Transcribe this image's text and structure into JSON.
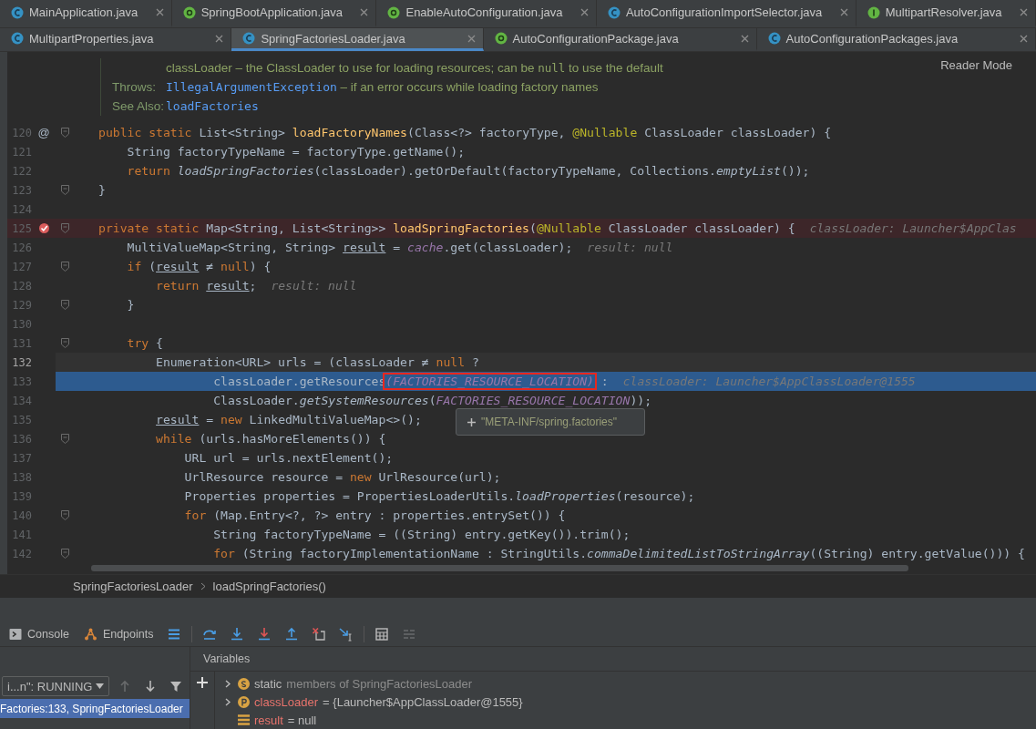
{
  "tab_rows": [
    [
      {
        "label": "MainApplication.java",
        "kind": "class",
        "selected": false
      },
      {
        "label": "SpringBootApplication.java",
        "kind": "annotation",
        "selected": false
      },
      {
        "label": "EnableAutoConfiguration.java",
        "kind": "annotation",
        "selected": false
      },
      {
        "label": "AutoConfigurationImportSelector.java",
        "kind": "class",
        "selected": false
      },
      {
        "label": "MultipartResolver.java",
        "kind": "interface",
        "selected": false
      }
    ],
    [
      {
        "label": "MultipartProperties.java",
        "kind": "class",
        "selected": false
      },
      {
        "label": "SpringFactoriesLoader.java",
        "kind": "class",
        "selected": true
      },
      {
        "label": "AutoConfigurationPackage.java",
        "kind": "annotation",
        "selected": false
      },
      {
        "label": "AutoConfigurationPackages.java",
        "kind": "class",
        "selected": false
      }
    ]
  ],
  "reader_mode": "Reader Mode",
  "doc": [
    {
      "parts": [
        {
          "kind": "text",
          "text": "classLoader – the ClassLoader to use for loading resources; can be "
        },
        {
          "kind": "mono",
          "text": "null"
        },
        {
          "kind": "text",
          "text": " to use the default"
        }
      ]
    },
    {
      "label": "Throws:",
      "parts": [
        {
          "kind": "link",
          "text": "IllegalArgumentException"
        },
        {
          "kind": "text",
          "text": " – if an error occurs while loading factory names"
        }
      ]
    },
    {
      "label": "See Also:",
      "parts": [
        {
          "kind": "link",
          "text": "loadFactories"
        }
      ]
    }
  ],
  "lines": [
    {
      "number": "120",
      "kind": "normal",
      "gutter_text": "@",
      "fold": true,
      "tokens": [
        {
          "kind": "kw",
          "text": "public static "
        },
        {
          "kind": "plain",
          "text": "List<String> "
        },
        {
          "kind": "decl",
          "text": "loadFactoryNames"
        },
        {
          "kind": "plain",
          "text": "(Class<?> factoryType, "
        },
        {
          "kind": "ann",
          "text": "@Nullable"
        },
        {
          "kind": "plain",
          "text": " ClassLoader classLoader) {"
        }
      ]
    },
    {
      "number": "121",
      "kind": "normal",
      "fold": false,
      "tokens": [
        {
          "kind": "plain",
          "text": "    String factoryTypeName = factoryType.getName();"
        }
      ]
    },
    {
      "number": "122",
      "kind": "normal",
      "fold": false,
      "tokens": [
        {
          "kind": "kw",
          "text": "    return "
        },
        {
          "kind": "italic",
          "text": "loadSpringFactories"
        },
        {
          "kind": "plain",
          "text": "(classLoader).getOrDefault(factoryTypeName, Collections."
        },
        {
          "kind": "italic",
          "text": "emptyList"
        },
        {
          "kind": "plain",
          "text": "());"
        }
      ]
    },
    {
      "number": "123",
      "kind": "normal",
      "fold": true,
      "tokens": [
        {
          "kind": "plain",
          "text": "}"
        }
      ]
    },
    {
      "number": "124",
      "kind": "normal",
      "fold": false
    },
    {
      "number": "125",
      "kind": "breakpoint",
      "fold": true,
      "tokens": [
        {
          "kind": "kw",
          "text": "private static "
        },
        {
          "kind": "plain",
          "text": "Map<String, List<String>> "
        },
        {
          "kind": "decl",
          "text": "loadSpringFactories"
        },
        {
          "kind": "plain",
          "text": "("
        },
        {
          "kind": "ann",
          "text": "@Nullable"
        },
        {
          "kind": "plain",
          "text": " ClassLoader classLoader) {"
        }
      ],
      "hint": "classLoader: Launcher$AppClas"
    },
    {
      "number": "126",
      "kind": "normal",
      "fold": false,
      "tokens": [
        {
          "kind": "plain",
          "text": "    MultiValueMap<String, String> "
        },
        {
          "kind": "under",
          "text": "result"
        },
        {
          "kind": "plain",
          "text": " = "
        },
        {
          "kind": "static",
          "text": "cache"
        },
        {
          "kind": "plain",
          "text": ".get(classLoader);"
        }
      ],
      "hint": "result: null"
    },
    {
      "number": "127",
      "kind": "normal",
      "fold": true,
      "tokens": [
        {
          "kind": "kw",
          "text": "    if "
        },
        {
          "kind": "plain",
          "text": "("
        },
        {
          "kind": "under",
          "text": "result"
        },
        {
          "kind": "plain",
          "text": " ≠ "
        },
        {
          "kind": "kw",
          "text": "null"
        },
        {
          "kind": "plain",
          "text": ") {"
        }
      ]
    },
    {
      "number": "128",
      "kind": "normal",
      "fold": false,
      "tokens": [
        {
          "kind": "kw",
          "text": "        return "
        },
        {
          "kind": "under",
          "text": "result"
        },
        {
          "kind": "plain",
          "text": ";"
        }
      ],
      "hint": "result: null"
    },
    {
      "number": "129",
      "kind": "normal",
      "fold": true,
      "tokens": [
        {
          "kind": "plain",
          "text": "    }"
        }
      ]
    },
    {
      "number": "130",
      "kind": "normal",
      "fold": false
    },
    {
      "number": "131",
      "kind": "normal",
      "fold": true,
      "tokens": [
        {
          "kind": "kw",
          "text": "    try "
        },
        {
          "kind": "plain",
          "text": "{"
        }
      ]
    },
    {
      "number": "132",
      "kind": "current",
      "fold": false,
      "tokens": [
        {
          "kind": "plain",
          "text": "        Enumeration<URL> urls = (classLoader ≠ "
        },
        {
          "kind": "kw",
          "text": "null"
        },
        {
          "kind": "plain",
          "text": " ?"
        }
      ]
    },
    {
      "number": "133",
      "kind": "execution",
      "fold": false,
      "tokens": [
        {
          "kind": "plain",
          "text": "                classLoader.getResources"
        },
        {
          "kind": "static",
          "text": "(FACTORIES_RESOURCE_LOCATION)",
          "boxed": true
        },
        {
          "kind": "plain",
          "text": " :"
        }
      ],
      "hint": "classLoader: Launcher$AppClassLoader@1555"
    },
    {
      "number": "134",
      "kind": "normal",
      "fold": false,
      "tokens": [
        {
          "kind": "plain",
          "text": "                ClassLoader."
        },
        {
          "kind": "italic",
          "text": "getSystemResources"
        },
        {
          "kind": "plain",
          "text": "("
        },
        {
          "kind": "static",
          "text": "FACTORIES_RESOURCE_LOCATION"
        },
        {
          "kind": "plain",
          "text": "));"
        }
      ]
    },
    {
      "number": "135",
      "kind": "normal",
      "fold": false,
      "tokens": [
        {
          "kind": "under",
          "text": "        result"
        },
        {
          "kind": "plain",
          "text": " = "
        },
        {
          "kind": "kw",
          "text": "new "
        },
        {
          "kind": "plain",
          "text": "LinkedMultiValueMap<>();"
        }
      ]
    },
    {
      "number": "136",
      "kind": "normal",
      "fold": true,
      "tokens": [
        {
          "kind": "kw",
          "text": "        while "
        },
        {
          "kind": "plain",
          "text": "(urls.hasMoreElements()) {"
        }
      ]
    },
    {
      "number": "137",
      "kind": "normal",
      "fold": false,
      "tokens": [
        {
          "kind": "plain",
          "text": "            URL url = urls.nextElement();"
        }
      ]
    },
    {
      "number": "138",
      "kind": "normal",
      "fold": false,
      "tokens": [
        {
          "kind": "plain",
          "text": "            UrlResource resource = "
        },
        {
          "kind": "kw",
          "text": "new "
        },
        {
          "kind": "plain",
          "text": "UrlResource(url);"
        }
      ]
    },
    {
      "number": "139",
      "kind": "normal",
      "fold": false,
      "tokens": [
        {
          "kind": "plain",
          "text": "            Properties properties = PropertiesLoaderUtils."
        },
        {
          "kind": "italic",
          "text": "loadProperties"
        },
        {
          "kind": "plain",
          "text": "(resource);"
        }
      ]
    },
    {
      "number": "140",
      "kind": "normal",
      "fold": true,
      "tokens": [
        {
          "kind": "kw",
          "text": "            for "
        },
        {
          "kind": "plain",
          "text": "(Map.Entry<?, ?> entry : properties.entrySet()) {"
        }
      ]
    },
    {
      "number": "141",
      "kind": "normal",
      "fold": false,
      "tokens": [
        {
          "kind": "plain",
          "text": "                String factoryTypeName = ((String) entry.getKey()).trim();"
        }
      ]
    },
    {
      "number": "142",
      "kind": "normal",
      "fold": true,
      "tokens": [
        {
          "kind": "kw",
          "text": "                for "
        },
        {
          "kind": "plain",
          "text": "(String factoryImplementationName : StringUtils."
        },
        {
          "kind": "italic",
          "text": "commaDelimitedListToStringArray"
        },
        {
          "kind": "plain",
          "text": "((String) entry.getValue())) {"
        }
      ]
    }
  ],
  "value_popup": {
    "text": "\"META-INF/spring.factories\""
  },
  "breadcrumbs": [
    "SpringFactoriesLoader",
    "loadSpringFactories()"
  ],
  "debug_tabs": [
    {
      "label": "Console",
      "kind": "console"
    },
    {
      "label": "Endpoints",
      "kind": "endpoints"
    }
  ],
  "toolbar_buttons": [
    {
      "kind": "layout",
      "disabled": false
    },
    {
      "kind": "step-over",
      "disabled": false
    },
    {
      "kind": "step-into",
      "disabled": false
    },
    {
      "kind": "force-step-into",
      "disabled": false
    },
    {
      "kind": "step-out",
      "disabled": false
    },
    {
      "kind": "drop-frame",
      "disabled": false
    },
    {
      "kind": "run-to-cursor",
      "disabled": false
    },
    {
      "kind": "evaluate",
      "disabled": false
    },
    {
      "kind": "trace",
      "disabled": true
    }
  ],
  "thread_selector": {
    "value": "i...n\": RUNNING"
  },
  "frame_nav": [
    {
      "kind": "up",
      "disabled": true
    },
    {
      "kind": "down",
      "disabled": false
    },
    {
      "kind": "filter",
      "disabled": false
    }
  ],
  "frames": [
    {
      "text": "Factories:133, SpringFactoriesLoader",
      "selected": true
    }
  ],
  "variables_title": "Variables",
  "variables": [
    {
      "kind": "static",
      "expandable": true,
      "name": "static",
      "value": "members of SpringFactoriesLoader"
    },
    {
      "kind": "param",
      "expandable": true,
      "name": "classLoader",
      "value": "= {Launcher$AppClassLoader@1555}"
    },
    {
      "kind": "field",
      "expandable": false,
      "name": "result",
      "value": "= null"
    }
  ]
}
